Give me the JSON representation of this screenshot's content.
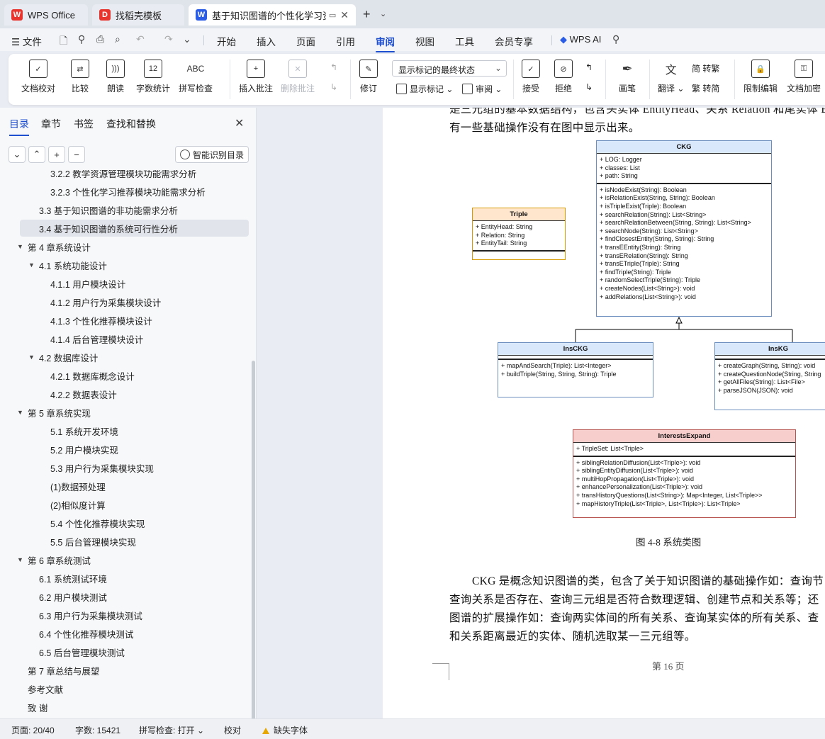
{
  "tabs": [
    {
      "label": "WPS Office",
      "logo_color": "#e8352e",
      "logo": "W"
    },
    {
      "label": "找稻壳模板",
      "logo_color": "#e8352e",
      "logo": "D"
    },
    {
      "label": "基于知识图谱的个性化学习资",
      "logo_color": "#2b5ce6",
      "logo": "W"
    }
  ],
  "menu": {
    "file": "文件",
    "items": [
      "开始",
      "插入",
      "页面",
      "引用",
      "审阅",
      "视图",
      "工具",
      "会员专享"
    ],
    "active": "审阅",
    "wps_ai": "WPS AI"
  },
  "ribbon": {
    "doc_check": "文档校对",
    "compare": "比较",
    "read_aloud": "朗读",
    "word_count": "字数统计",
    "spell_check": "拼写检查",
    "spell_icon": "ABC",
    "word_count_icon": "12",
    "insert_comment": "插入批注",
    "delete_comment": "删除批注",
    "revise": "修订",
    "mark_state": "显示标记的最终状态",
    "show_marks": "显示标记",
    "review": "审阅",
    "accept": "接受",
    "reject": "拒绝",
    "pen": "画笔",
    "translate": "翻译",
    "to_trad": "转繁",
    "to_simp": "转简",
    "restrict_edit": "限制编辑",
    "doc_encrypt": "文档加密"
  },
  "nav": {
    "tabs": [
      "目录",
      "章节",
      "书签",
      "查找和替换"
    ],
    "active_tab": "目录",
    "ai_toc": "智能识别目录",
    "toc": [
      {
        "text": "3.2.2 教学资源管理模块功能需求分析",
        "level": 3
      },
      {
        "text": "3.2.3 个性化学习推荐模块功能需求分析",
        "level": 3
      },
      {
        "text": "3.3  基于知识图谱的非功能需求分析",
        "level": 2
      },
      {
        "text": "3.4  基于知识图谱的系统可行性分析",
        "level": 2,
        "selected": true
      },
      {
        "text": "第 4 章系统设计",
        "level": 1,
        "expanded": true
      },
      {
        "text": "4.1  系统功能设计",
        "level": 2,
        "expanded": true
      },
      {
        "text": "4.1.1  用户模块设计",
        "level": 3
      },
      {
        "text": "4.1.2  用户行为采集模块设计",
        "level": 3
      },
      {
        "text": "4.1.3  个性化推荐模块设计",
        "level": 3
      },
      {
        "text": "4.1.4  后台管理模块设计",
        "level": 3
      },
      {
        "text": "4.2  数据库设计",
        "level": 2,
        "expanded": true
      },
      {
        "text": "4.2.1  数据库概念设计",
        "level": 3
      },
      {
        "text": "4.2.2  数据表设计",
        "level": 3
      },
      {
        "text": "第 5 章系统实现",
        "level": 1,
        "expanded": true
      },
      {
        "text": "5.1  系统开发环境",
        "level": 3
      },
      {
        "text": "5.2  用户模块实现",
        "level": 3
      },
      {
        "text": "5.3  用户行为采集模块实现",
        "level": 3
      },
      {
        "text": "(1)数据预处理",
        "level": 3
      },
      {
        "text": "(2)相似度计算",
        "level": 3
      },
      {
        "text": "5.4  个性化推荐模块实现",
        "level": 3
      },
      {
        "text": "5.5  后台管理模块实现",
        "level": 3
      },
      {
        "text": "第 6 章系统测试",
        "level": 1,
        "expanded": true
      },
      {
        "text": "6.1  系统测试环境",
        "level": 2
      },
      {
        "text": "6.2  用户模块测试",
        "level": 2
      },
      {
        "text": "6.3 用户行为采集模块测试",
        "level": 2
      },
      {
        "text": "6.4  个性化推荐模块测试",
        "level": 2
      },
      {
        "text": "6.5  后台管理模块测试",
        "level": 2
      },
      {
        "text": "第 7 章总结与展望",
        "level": 1
      },
      {
        "text": "参考文献",
        "level": 1
      },
      {
        "text": "致      谢",
        "level": 1
      }
    ]
  },
  "doc": {
    "intro_line1": "是三元组的基本数据结构，包含头实体 EntityHead、关系 Relation 和尾实体 E",
    "intro_line2": "有一些基础操作没有在图中显示出来。",
    "caption": "图 4-8  系统类图",
    "body": [
      "CKG 是概念知识图谱的类，包含了关于知识图谱的基础操作如：查询节",
      "查询关系是否存在、查询三元组是否符合数理逻辑、创建节点和关系等；还",
      "图谱的扩展操作如：查询两实体间的所有关系、查询某实体的所有关系、查",
      "和关系距离最近的实体、随机选取某一三元组等。"
    ],
    "page_number": "第 16 页"
  },
  "uml": {
    "ckg": {
      "name": "CKG",
      "fields": [
        "+ LOG: Logger",
        "+ classes: List",
        "+ path: String"
      ],
      "methods": [
        "+ isNodeExist(String): Boolean",
        "+ isRelationExist(String, String): Boolean",
        "+ isTripleExist(Triple): Boolean",
        "+ searchRelation(String): List<String>",
        "+ searchRelationBetween(String, String): List<String>",
        "+ searchNode(String): List<String>",
        "+ findClosestEntity(String, String): String",
        "+ transEEntity(String): String",
        "+ transERelation(String): String",
        "+ transETriple(Triple): String",
        "+ findTriple(String): Triple",
        "+ randomSelectTriple(String): Triple",
        "+ createNodes(List<String>): void",
        "+ addRelations(List<String>): void"
      ]
    },
    "triple": {
      "name": "Triple",
      "fields": [
        "+ EntityHead: String",
        "+ Relation: String",
        "+ EntityTail: String"
      ]
    },
    "insckg": {
      "name": "InsCKG",
      "methods": [
        "+ mapAndSearch(Triple): List<Integer>",
        "+ buildTriple(String, String, String): Triple"
      ]
    },
    "inskg": {
      "name": "InsKG",
      "methods": [
        "+ createGraph(String, String): void",
        "+ createQuestionNode(String, String",
        "+ getAllFiles(String): List<File>",
        "+ parseJSON(JSON): void"
      ]
    },
    "interests": {
      "name": "InterestsExpand",
      "fields": [
        "+ TripleSet: List<Triple>"
      ],
      "methods": [
        "+ siblingRelationDiffusion(List<Triple>): void",
        "+ siblingEntityDiffusion(List<Triple>): void",
        "+ multiHopPropagation(List<Triple>): void",
        "+ enhancePersonalization(List<Triple>): void",
        "+ transHistoryQuestions(List<String>):  Map<Integer, List<Triple>>",
        "+ mapHistoryTriple(List<Triple>, List<Triple>): List<Triple>"
      ]
    }
  },
  "status": {
    "page": "页面: 20/40",
    "words": "字数: 15421",
    "spell": "拼写检查: 打开",
    "proof": "校对",
    "missing_font": "缺失字体"
  },
  "colors": {
    "accent": "#1f4fd1",
    "uml_blue": "#dae8fc",
    "uml_orange": "#ffe6cc",
    "uml_red": "#f8cecc"
  }
}
